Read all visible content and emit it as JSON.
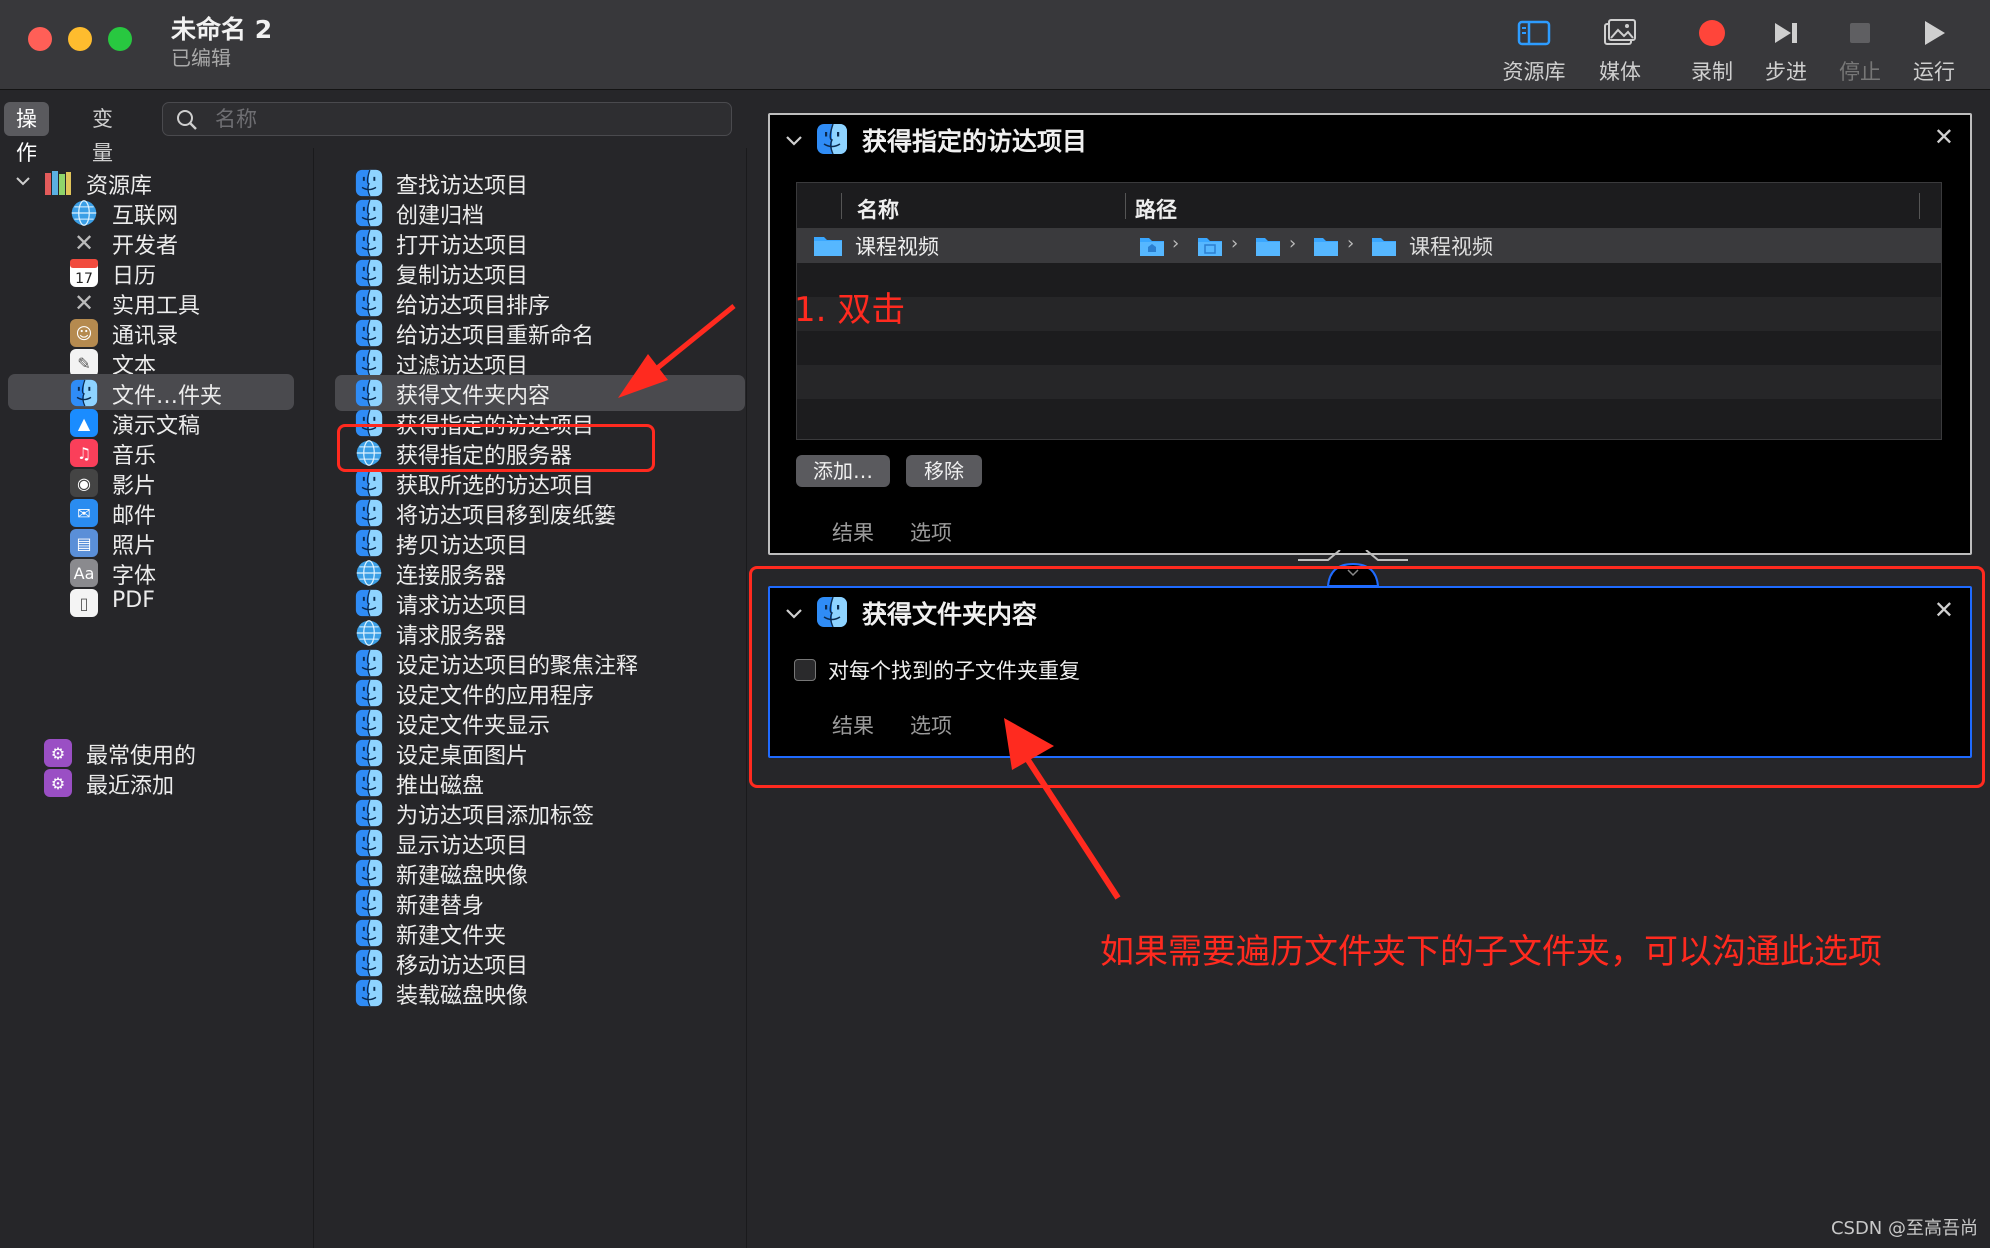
{
  "window": {
    "title": "未命名 2",
    "subtitle": "已编辑",
    "traffic_colors": {
      "close": "#ff5f57",
      "minimize": "#febc2e",
      "maximize": "#28c840"
    }
  },
  "toolbar": {
    "library_label": "资源库",
    "media_label": "媒体",
    "record_label": "录制",
    "step_label": "步进",
    "stop_label": "停止",
    "run_label": "运行"
  },
  "sidebar": {
    "tabs": [
      "操作",
      "变量"
    ],
    "search_placeholder": "名称",
    "library": {
      "root": "资源库",
      "items": [
        {
          "label": "互联网",
          "icon": "globe-icon"
        },
        {
          "label": "开发者",
          "icon": "tools-icon"
        },
        {
          "label": "日历",
          "icon": "calendar-icon",
          "badge": "17"
        },
        {
          "label": "实用工具",
          "icon": "tools-icon"
        },
        {
          "label": "通讯录",
          "icon": "contacts-icon"
        },
        {
          "label": "文本",
          "icon": "text-icon"
        },
        {
          "label": "文件…件夹",
          "icon": "finder-icon",
          "selected": true
        },
        {
          "label": "演示文稿",
          "icon": "keynote-icon"
        },
        {
          "label": "音乐",
          "icon": "music-icon"
        },
        {
          "label": "影片",
          "icon": "movie-icon"
        },
        {
          "label": "邮件",
          "icon": "mail-icon"
        },
        {
          "label": "照片",
          "icon": "photos-icon"
        },
        {
          "label": "字体",
          "icon": "font-icon"
        },
        {
          "label": "PDF",
          "icon": "pdf-icon"
        }
      ],
      "smart_folders": [
        "最常使用的",
        "最近添加"
      ]
    },
    "actions": [
      {
        "label": "查找访达项目",
        "icon": "finder-icon"
      },
      {
        "label": "创建归档",
        "icon": "finder-icon"
      },
      {
        "label": "打开访达项目",
        "icon": "finder-icon"
      },
      {
        "label": "复制访达项目",
        "icon": "finder-icon"
      },
      {
        "label": "给访达项目排序",
        "icon": "finder-icon"
      },
      {
        "label": "给访达项目重新命名",
        "icon": "finder-icon"
      },
      {
        "label": "过滤访达项目",
        "icon": "finder-icon"
      },
      {
        "label": "获得文件夹内容",
        "icon": "finder-icon",
        "selected": true
      },
      {
        "label": "获得指定的访达项目",
        "icon": "finder-icon"
      },
      {
        "label": "获得指定的服务器",
        "icon": "network-icon"
      },
      {
        "label": "获取所选的访达项目",
        "icon": "finder-icon"
      },
      {
        "label": "将访达项目移到废纸篓",
        "icon": "finder-icon"
      },
      {
        "label": "拷贝访达项目",
        "icon": "finder-icon"
      },
      {
        "label": "连接服务器",
        "icon": "network-icon"
      },
      {
        "label": "请求访达项目",
        "icon": "finder-icon"
      },
      {
        "label": "请求服务器",
        "icon": "network-icon"
      },
      {
        "label": "设定访达项目的聚焦注释",
        "icon": "finder-icon"
      },
      {
        "label": "设定文件的应用程序",
        "icon": "finder-icon"
      },
      {
        "label": "设定文件夹显示",
        "icon": "finder-icon"
      },
      {
        "label": "设定桌面图片",
        "icon": "finder-icon"
      },
      {
        "label": "推出磁盘",
        "icon": "finder-icon"
      },
      {
        "label": "为访达项目添加标签",
        "icon": "finder-icon"
      },
      {
        "label": "显示访达项目",
        "icon": "finder-icon"
      },
      {
        "label": "新建磁盘映像",
        "icon": "finder-icon"
      },
      {
        "label": "新建替身",
        "icon": "finder-icon"
      },
      {
        "label": "新建文件夹",
        "icon": "finder-icon"
      },
      {
        "label": "移动访达项目",
        "icon": "finder-icon"
      },
      {
        "label": "装载磁盘映像",
        "icon": "finder-icon"
      }
    ]
  },
  "workflow": {
    "panel1": {
      "title": "获得指定的访达项目",
      "columns": [
        "名称",
        "路径"
      ],
      "rows": [
        {
          "name": "课程视频",
          "path_last": "课程视频"
        }
      ],
      "add_label": "添加…",
      "remove_label": "移除",
      "footer_tabs": [
        "结果",
        "选项"
      ]
    },
    "panel2": {
      "title": "获得文件夹内容",
      "checkbox_label": "对每个找到的子文件夹重复",
      "checked": false,
      "footer_tabs": [
        "结果",
        "选项"
      ]
    }
  },
  "annotations": {
    "double_click": "1. 双击",
    "note": "如果需要遍历文件夹下的子文件夹，可以沟通此选项",
    "color": "#ff2a1f"
  },
  "watermark": "CSDN @至高吾尚"
}
